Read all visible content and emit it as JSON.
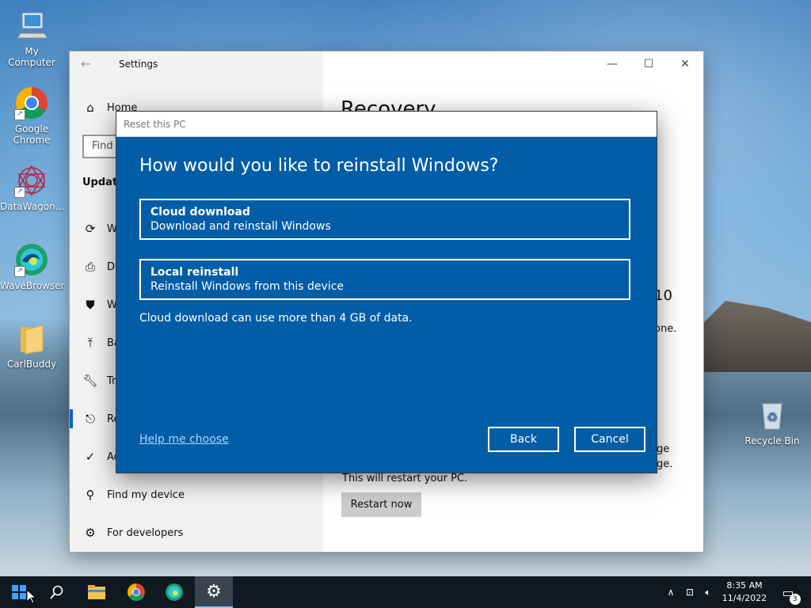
{
  "desktop": {
    "icons": [
      {
        "label": "My Computer",
        "name": "monitor-icon"
      },
      {
        "label": "Google Chrome",
        "name": "chrome-icon"
      },
      {
        "label": "DataWagon...",
        "name": "datawagon-icon"
      },
      {
        "label": "WaveBrowser",
        "name": "wavebrowser-icon"
      },
      {
        "label": "CarlBuddy",
        "name": "folder-icon"
      },
      {
        "label": "Recycle Bin",
        "name": "recycle-bin-icon"
      }
    ]
  },
  "settings": {
    "title": "Settings",
    "sidebar": {
      "home": "Home",
      "search_placeholder": "Find",
      "section": "Update",
      "items": [
        {
          "label": "W",
          "icon": "refresh-icon"
        },
        {
          "label": "De",
          "icon": "delivery-icon"
        },
        {
          "label": "W",
          "icon": "shield-icon"
        },
        {
          "label": "Ba",
          "icon": "backup-icon"
        },
        {
          "label": "Tr",
          "icon": "wrench-icon"
        },
        {
          "label": "Re",
          "icon": "recovery-icon"
        },
        {
          "label": "Ac",
          "icon": "check-circle-icon"
        },
        {
          "label": "Find my device",
          "icon": "person-icon"
        },
        {
          "label": "For developers",
          "icon": "developer-icon"
        }
      ]
    },
    "main": {
      "title": "Recovery",
      "frag_10": "10",
      "frag_one": "one.",
      "frag_ge": "ge",
      "frag_age": "age.",
      "restart_text": "This will restart your PC.",
      "restart_button": "Restart now"
    }
  },
  "dialog": {
    "title": "Reset this PC",
    "heading": "How would you like to reinstall Windows?",
    "options": [
      {
        "title": "Cloud download",
        "desc": "Download and reinstall Windows"
      },
      {
        "title": "Local reinstall",
        "desc": "Reinstall Windows from this device"
      }
    ],
    "note": "Cloud download can use more than 4 GB of data.",
    "help_link": "Help me choose",
    "back": "Back",
    "cancel": "Cancel"
  },
  "taskbar": {
    "time": "8:35 AM",
    "date": "11/4/2022",
    "notification_count": "3"
  }
}
